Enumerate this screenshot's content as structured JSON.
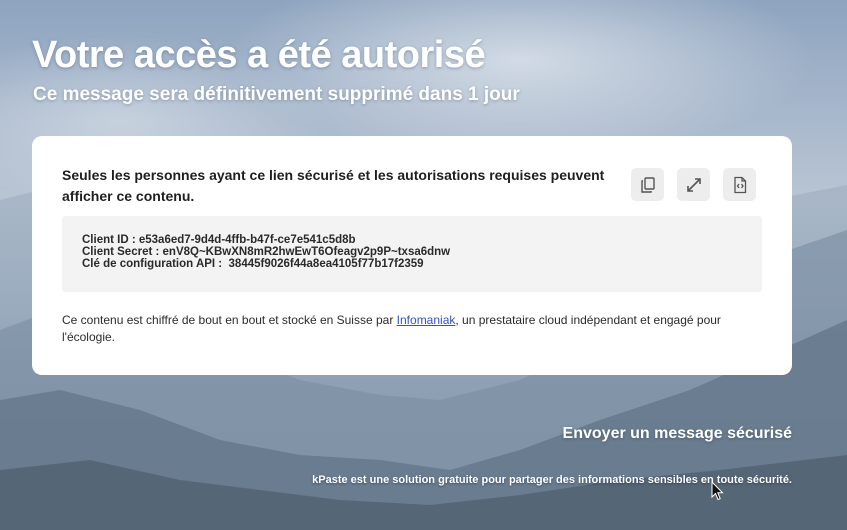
{
  "header": {
    "title": "Votre accès a été autorisé",
    "subtitle": "Ce message sera définitivement supprimé dans 1 jour"
  },
  "card": {
    "intro": "Seules les personnes ayant ce lien sécurisé et les autorisations requises peuvent afficher ce contenu.",
    "actions": [
      {
        "name": "copy-button",
        "icon": "copy-icon"
      },
      {
        "name": "expand-button",
        "icon": "expand-icon"
      },
      {
        "name": "code-view-button",
        "icon": "file-code-icon"
      }
    ],
    "secret_lines": [
      "Client ID : e53a6ed7-9d4d-4ffb-b47f-ce7e541c5d8b",
      "Client Secret : enV8Q~KBwXN8mR2hwEwT6Ofeagv2p9P~txsa6dnw",
      "Clé de configuration API :  38445f9026f44a8ea4105f77b17f2359"
    ],
    "footer_before": "Ce contenu est chiffré de bout en bout et stocké en Suisse par ",
    "footer_link": "Infomaniak",
    "footer_after": ", un prestataire cloud indépendant et engagé pour l'écologie."
  },
  "bottom": {
    "send_link": "Envoyer un message sécurisé",
    "tagline": "kPaste est une solution gratuite pour partager des informations sensibles en toute sécurité."
  },
  "colors": {
    "link": "#2f52c8",
    "card_bg": "#ffffff",
    "secret_bg": "#f3f3f3",
    "action_bg": "#ededed"
  }
}
